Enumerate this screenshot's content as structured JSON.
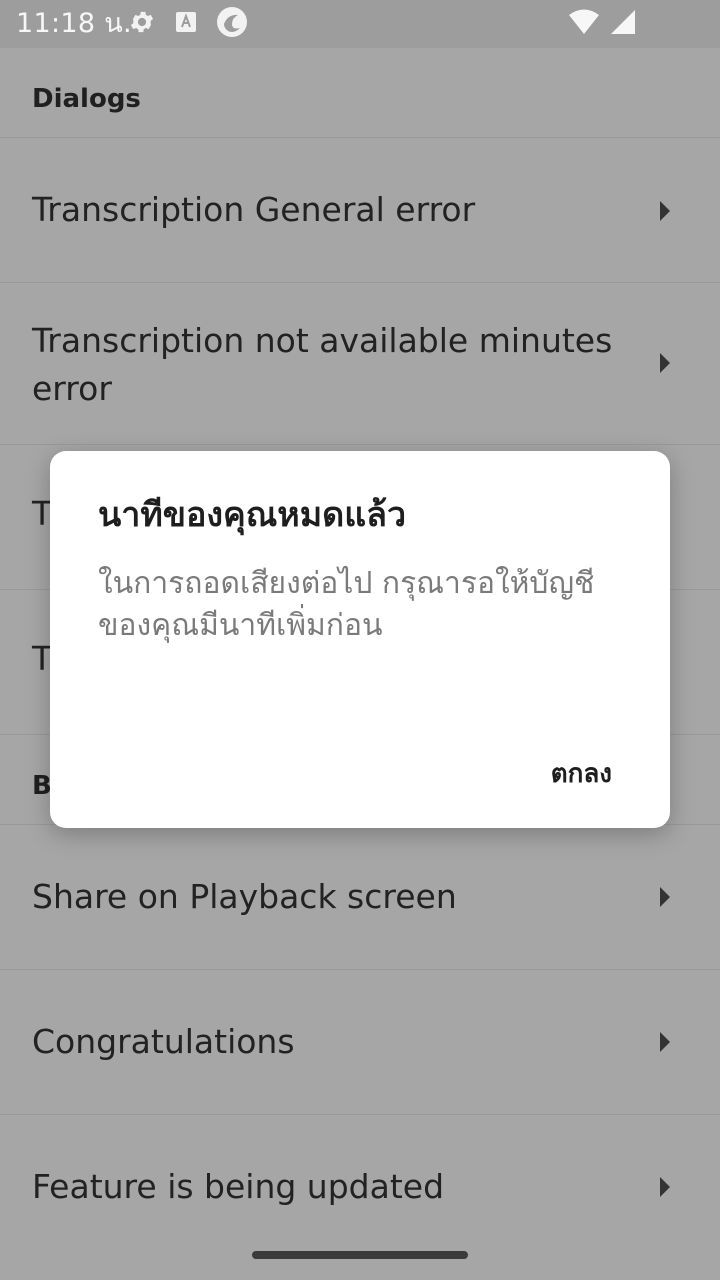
{
  "status_bar": {
    "time": "11:18 น.",
    "icons_left": [
      "settings-gear-icon",
      "text-a-icon",
      "app-circle-icon"
    ],
    "icons_right": [
      "wifi-icon",
      "signal-icon"
    ]
  },
  "list": {
    "section_header": "Dialogs",
    "items": [
      {
        "label": "Transcription General error"
      },
      {
        "label": "Transcription not available minutes error"
      },
      {
        "label": "T"
      },
      {
        "label": "T"
      }
    ],
    "section2_header_partial": "B",
    "items2": [
      {
        "label": "Share on Playback screen"
      },
      {
        "label": "Congratulations"
      },
      {
        "label": "Feature is being updated"
      }
    ]
  },
  "dialog": {
    "title": "นาทีของคุณหมดแล้ว",
    "message": "ในการถอดเสียงต่อไป กรุณารอให้บัญชีของคุณมีนาทีเพิ่มก่อน",
    "ok_label": "ตกลง"
  },
  "colors": {
    "scrim_background": "#a6a6a6",
    "dialog_background": "#ffffff",
    "title_text": "#1e1e1e",
    "message_text": "#7a7a7a"
  }
}
